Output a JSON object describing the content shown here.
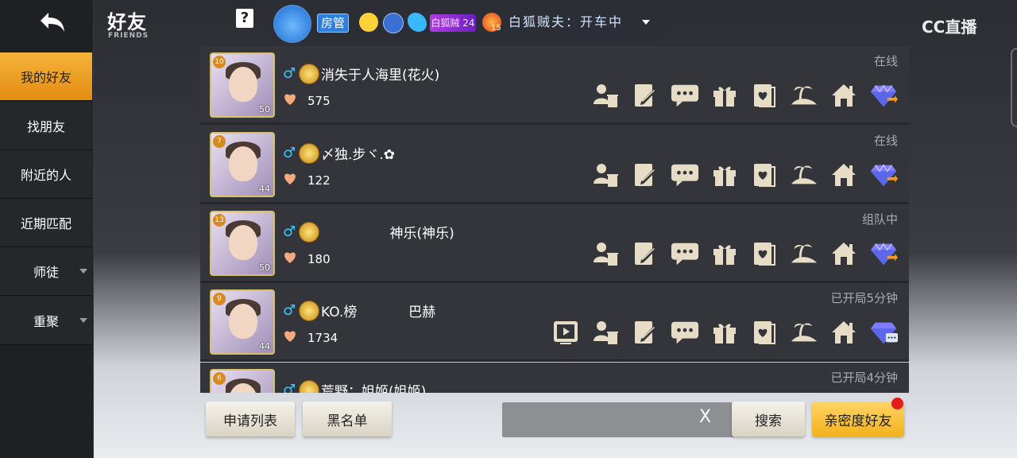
{
  "header": {
    "title": "好友",
    "subtitle": "FRIENDS",
    "help_label": "?",
    "room_badge": "房管",
    "room_user_badge": "白狐贼",
    "room_user_badge_level": "24",
    "room_icon_level": "15",
    "room_name": "白狐贼夫：开车中",
    "watermark": "CC直播"
  },
  "sidebar": {
    "items": [
      {
        "label": "我的好友",
        "active": true
      },
      {
        "label": "找朋友"
      },
      {
        "label": "附近的人"
      },
      {
        "label": "近期匹配"
      },
      {
        "label": "师徒"
      },
      {
        "label": "重聚"
      }
    ]
  },
  "friends": [
    {
      "name": "消失于人海里(花火)",
      "intimacy": "575",
      "status": "在线",
      "rank_level": "10",
      "avatar_level": "50"
    },
    {
      "name": "〆独.步ヾ.✿",
      "intimacy": "122",
      "status": "在线",
      "rank_level": "7",
      "avatar_level": "44"
    },
    {
      "name": "                神乐(神乐)",
      "intimacy": "180",
      "status": "组队中",
      "rank_level": "13",
      "avatar_level": "50"
    },
    {
      "name": "KO.榜            巴赫",
      "intimacy": "1734",
      "status": "已开局5分钟",
      "rank_level": "9",
      "avatar_level": "44"
    },
    {
      "name": "荒野：姐姬(姐姬)",
      "intimacy": "",
      "status": "已开局4分钟",
      "rank_level": "6",
      "avatar_level": ""
    }
  ],
  "bottom": {
    "apply_list": "申请列表",
    "blacklist": "黑名单",
    "search_placeholder": "",
    "clear_symbol": "X",
    "search_button": "搜索",
    "intimacy_button": "亲密度好友"
  },
  "icons": [
    "remove-friend-icon",
    "note-icon",
    "chat-icon",
    "gift-icon",
    "card-icon",
    "island-icon",
    "home-icon",
    "gem-icon"
  ],
  "colors": {
    "accent": "#f2b21c",
    "sidebar_active": "#e9a125",
    "gender": "#3cc7ff"
  }
}
